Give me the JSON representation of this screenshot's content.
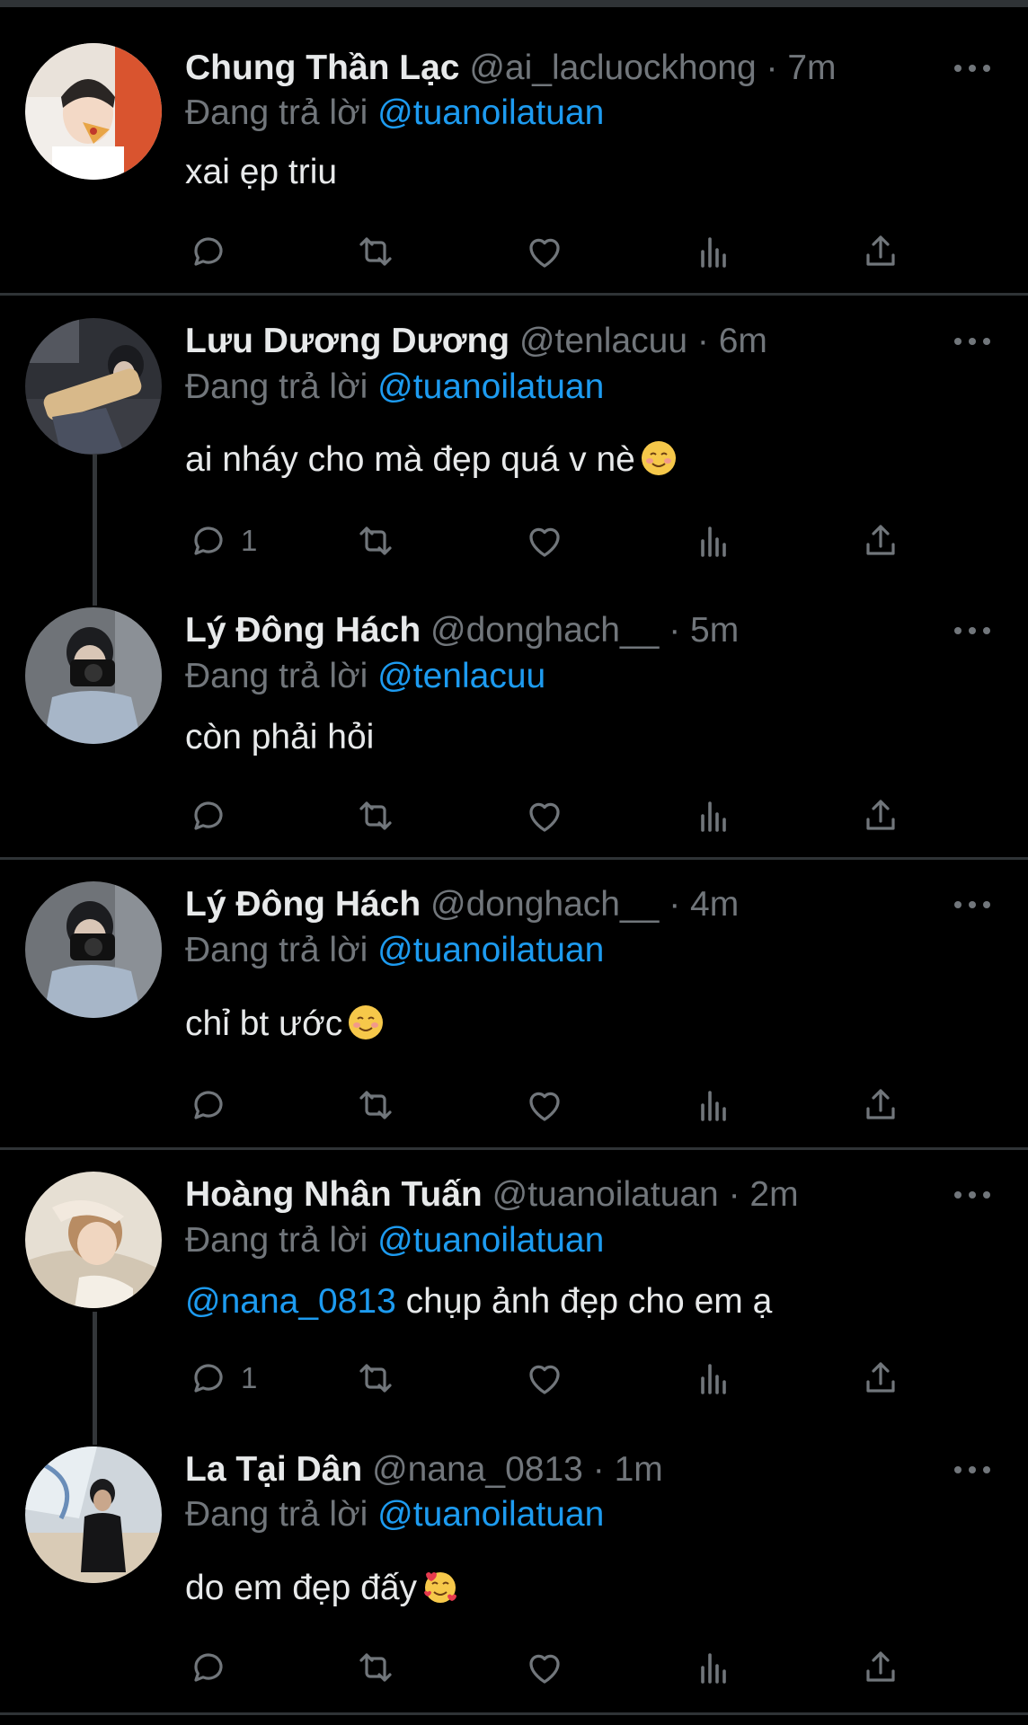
{
  "colors": {
    "background": "#000000",
    "mention": "#1d9bf0",
    "secondary": "#71767b",
    "primary_text": "#e7e9ea"
  },
  "replying_label": "Đang trả lời",
  "tweets": [
    {
      "name": "Chung Thần Lạc",
      "handle": "@ai_lacluockhong",
      "dot": "·",
      "time": "7m",
      "replying_to": "@tuanoilatuan",
      "text": "xai ẹp triu",
      "mention": "",
      "reply_count": "",
      "emoji": ""
    },
    {
      "name": "Lưu Dương Dương",
      "handle": "@tenlacuu",
      "dot": "·",
      "time": "6m",
      "replying_to": "@tuanoilatuan",
      "text": "ai nháy cho mà đẹp quá v nè",
      "mention": "",
      "reply_count": "1",
      "emoji": "smiling-face-emoji"
    },
    {
      "name": "Lý Đông Hách",
      "handle": "@donghach__",
      "dot": "·",
      "time": "5m",
      "replying_to": "@tenlacuu",
      "text": "còn phải hỏi",
      "mention": "",
      "reply_count": "",
      "emoji": ""
    },
    {
      "name": "Lý Đông Hách",
      "handle": "@donghach__",
      "dot": "·",
      "time": "4m",
      "replying_to": "@tuanoilatuan",
      "text": "chỉ bt ước",
      "mention": "",
      "reply_count": "",
      "emoji": "smiling-face-emoji"
    },
    {
      "name": "Hoàng Nhân Tuấn",
      "handle": "@tuanoilatuan",
      "dot": "·",
      "time": "2m",
      "replying_to": "@tuanoilatuan",
      "text": "chụp ảnh đẹp cho em ạ",
      "mention": "@nana_0813",
      "reply_count": "1",
      "emoji": ""
    },
    {
      "name": "La Tại Dân",
      "handle": "@nana_0813",
      "dot": "·",
      "time": "1m",
      "replying_to": "@tuanoilatuan",
      "text": "do em đẹp đấy",
      "mention": "",
      "reply_count": "",
      "emoji": "smiling-face-with-hearts-emoji"
    }
  ]
}
